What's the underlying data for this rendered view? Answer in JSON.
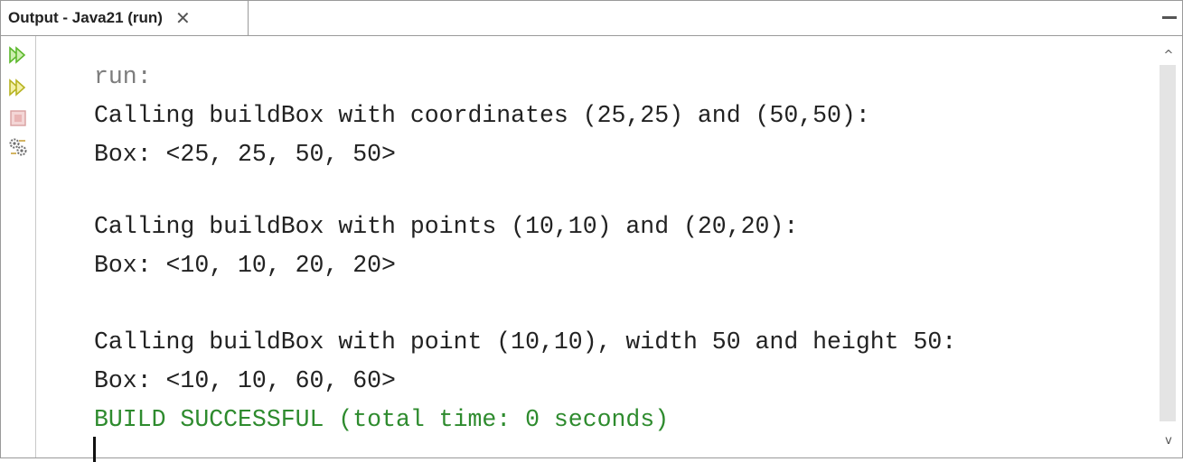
{
  "tab": {
    "title": "Output - Java21 (run)",
    "close_glyph": "✕"
  },
  "gutter_icons": [
    "rerun-icon",
    "rerun-with-options-icon",
    "stop-icon",
    "settings-icon"
  ],
  "console": {
    "lines": [
      "run:",
      "Calling buildBox with coordinates (25,25) and (50,50):",
      "Box: <25, 25, 50, 50>",
      "",
      "Calling buildBox with points (10,10) and (20,20):",
      "Box: <10, 10, 20, 20>",
      "",
      "Calling buildBox with point (10,10), width 50 and height 50:",
      "Box: <10, 10, 60, 60>",
      "BUILD SUCCESSFUL (total time: 0 seconds)"
    ]
  },
  "scrollbar": {
    "up_glyph": "^",
    "down_glyph": "v"
  },
  "colors": {
    "run_text": "#7d7d7d",
    "output_text": "#222222",
    "success_text": "#2e8b2e",
    "rerun_green": "#5cb82c"
  }
}
